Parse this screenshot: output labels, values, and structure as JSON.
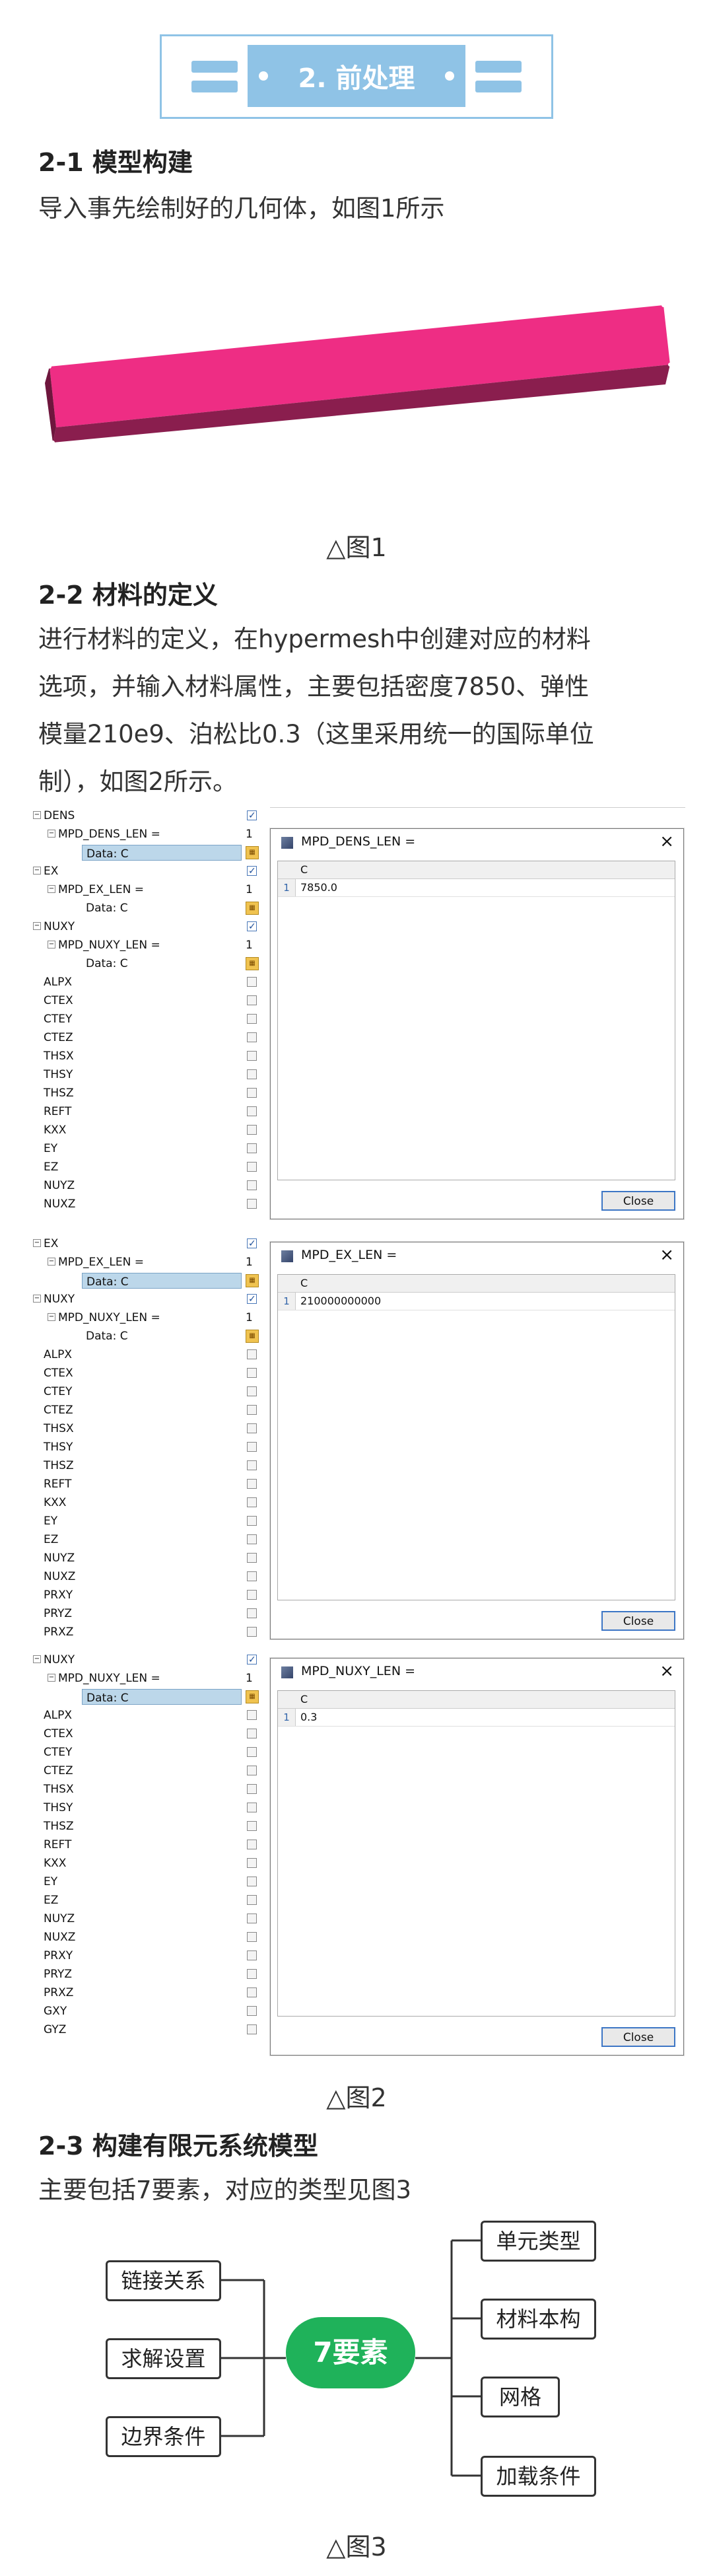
{
  "section": {
    "title": "2. 前处理"
  },
  "s1": {
    "heading": "2-1 模型构建",
    "text": "导入事先绘制好的几何体，如图1所示",
    "caption": "△图1"
  },
  "s2": {
    "heading": "2-2 材料的定义",
    "lines": [
      "进行材料的定义，在hypermesh中创建对应的材料",
      "选项，并输入材料属性，主要包括密度7850、弹性",
      "模量210e9、泊松比0.3（这里采用统一的国际单位",
      "制），如图2所示。"
    ],
    "caption": "△图2"
  },
  "panel1": {
    "tree": [
      {
        "label": "DENS",
        "ind": 0,
        "kind": "check-on",
        "box": "−"
      },
      {
        "label": "MPD_DENS_LEN =",
        "ind": 1,
        "kind": "value",
        "value": "1",
        "box": "−"
      },
      {
        "label": "Data: C",
        "ind": 2,
        "kind": "selected"
      },
      {
        "label": "EX",
        "ind": 0,
        "kind": "check-on",
        "box": "−"
      },
      {
        "label": "MPD_EX_LEN =",
        "ind": 1,
        "kind": "value",
        "value": "1",
        "box": "−"
      },
      {
        "label": "Data: C",
        "ind": 2,
        "kind": "data"
      },
      {
        "label": "NUXY",
        "ind": 0,
        "kind": "check-on",
        "box": "−"
      },
      {
        "label": "MPD_NUXY_LEN =",
        "ind": 1,
        "kind": "value",
        "value": "1",
        "box": "−"
      },
      {
        "label": "Data: C",
        "ind": 2,
        "kind": "data"
      },
      {
        "label": "ALPX",
        "ind": 0,
        "kind": "check"
      },
      {
        "label": "CTEX",
        "ind": 0,
        "kind": "check"
      },
      {
        "label": "CTEY",
        "ind": 0,
        "kind": "check"
      },
      {
        "label": "CTEZ",
        "ind": 0,
        "kind": "check"
      },
      {
        "label": "THSX",
        "ind": 0,
        "kind": "check"
      },
      {
        "label": "THSY",
        "ind": 0,
        "kind": "check"
      },
      {
        "label": "THSZ",
        "ind": 0,
        "kind": "check"
      },
      {
        "label": "REFT",
        "ind": 0,
        "kind": "check"
      },
      {
        "label": "KXX",
        "ind": 0,
        "kind": "check"
      },
      {
        "label": "EY",
        "ind": 0,
        "kind": "check"
      },
      {
        "label": "EZ",
        "ind": 0,
        "kind": "check"
      },
      {
        "label": "NUYZ",
        "ind": 0,
        "kind": "check"
      },
      {
        "label": "NUXZ",
        "ind": 0,
        "kind": "check"
      }
    ],
    "dialog": {
      "title": "MPD_DENS_LEN =",
      "col": "C",
      "row": "1",
      "value": "7850.0",
      "close": "Close"
    }
  },
  "panel2": {
    "tree": [
      {
        "label": "EX",
        "ind": 0,
        "kind": "check-on",
        "box": "−"
      },
      {
        "label": "MPD_EX_LEN =",
        "ind": 1,
        "kind": "value",
        "value": "1",
        "box": "−"
      },
      {
        "label": "Data: C",
        "ind": 2,
        "kind": "selected"
      },
      {
        "label": "NUXY",
        "ind": 0,
        "kind": "check-on",
        "box": "−"
      },
      {
        "label": "MPD_NUXY_LEN =",
        "ind": 1,
        "kind": "value",
        "value": "1",
        "box": "−"
      },
      {
        "label": "Data: C",
        "ind": 2,
        "kind": "data"
      },
      {
        "label": "ALPX",
        "ind": 0,
        "kind": "check"
      },
      {
        "label": "CTEX",
        "ind": 0,
        "kind": "check"
      },
      {
        "label": "CTEY",
        "ind": 0,
        "kind": "check"
      },
      {
        "label": "CTEZ",
        "ind": 0,
        "kind": "check"
      },
      {
        "label": "THSX",
        "ind": 0,
        "kind": "check"
      },
      {
        "label": "THSY",
        "ind": 0,
        "kind": "check"
      },
      {
        "label": "THSZ",
        "ind": 0,
        "kind": "check"
      },
      {
        "label": "REFT",
        "ind": 0,
        "kind": "check"
      },
      {
        "label": "KXX",
        "ind": 0,
        "kind": "check"
      },
      {
        "label": "EY",
        "ind": 0,
        "kind": "check"
      },
      {
        "label": "EZ",
        "ind": 0,
        "kind": "check"
      },
      {
        "label": "NUYZ",
        "ind": 0,
        "kind": "check"
      },
      {
        "label": "NUXZ",
        "ind": 0,
        "kind": "check"
      },
      {
        "label": "PRXY",
        "ind": 0,
        "kind": "check"
      },
      {
        "label": "PRYZ",
        "ind": 0,
        "kind": "check"
      },
      {
        "label": "PRXZ",
        "ind": 0,
        "kind": "check"
      }
    ],
    "dialog": {
      "title": "MPD_EX_LEN =",
      "col": "C",
      "row": "1",
      "value": "210000000000",
      "close": "Close"
    }
  },
  "panel3": {
    "tree": [
      {
        "label": "NUXY",
        "ind": 0,
        "kind": "check-on",
        "box": "−"
      },
      {
        "label": "MPD_NUXY_LEN =",
        "ind": 1,
        "kind": "value",
        "value": "1",
        "box": "−"
      },
      {
        "label": "Data: C",
        "ind": 2,
        "kind": "selected"
      },
      {
        "label": "ALPX",
        "ind": 0,
        "kind": "check"
      },
      {
        "label": "CTEX",
        "ind": 0,
        "kind": "check"
      },
      {
        "label": "CTEY",
        "ind": 0,
        "kind": "check"
      },
      {
        "label": "CTEZ",
        "ind": 0,
        "kind": "check"
      },
      {
        "label": "THSX",
        "ind": 0,
        "kind": "check"
      },
      {
        "label": "THSY",
        "ind": 0,
        "kind": "check"
      },
      {
        "label": "THSZ",
        "ind": 0,
        "kind": "check"
      },
      {
        "label": "REFT",
        "ind": 0,
        "kind": "check"
      },
      {
        "label": "KXX",
        "ind": 0,
        "kind": "check"
      },
      {
        "label": "EY",
        "ind": 0,
        "kind": "check"
      },
      {
        "label": "EZ",
        "ind": 0,
        "kind": "check"
      },
      {
        "label": "NUYZ",
        "ind": 0,
        "kind": "check"
      },
      {
        "label": "NUXZ",
        "ind": 0,
        "kind": "check"
      },
      {
        "label": "PRXY",
        "ind": 0,
        "kind": "check"
      },
      {
        "label": "PRYZ",
        "ind": 0,
        "kind": "check"
      },
      {
        "label": "PRXZ",
        "ind": 0,
        "kind": "check"
      },
      {
        "label": "GXY",
        "ind": 0,
        "kind": "check"
      },
      {
        "label": "GYZ",
        "ind": 0,
        "kind": "check"
      }
    ],
    "dialog": {
      "title": "MPD_NUXY_LEN =",
      "col": "C",
      "row": "1",
      "value": "0.3",
      "close": "Close"
    }
  },
  "s3": {
    "heading": "2-3 构建有限元系统模型",
    "text": "主要包括7要素，对应的类型见图3",
    "caption": "△图3",
    "center": "7要素",
    "left": [
      "链接关系",
      "求解设置",
      "边界条件"
    ],
    "right": [
      "单元类型",
      "材料本构",
      "网格",
      "加载条件"
    ]
  },
  "colors": {
    "accent": "#8fc3e6",
    "beam": "#ee2d84",
    "mindmap": "#1fb25a"
  }
}
